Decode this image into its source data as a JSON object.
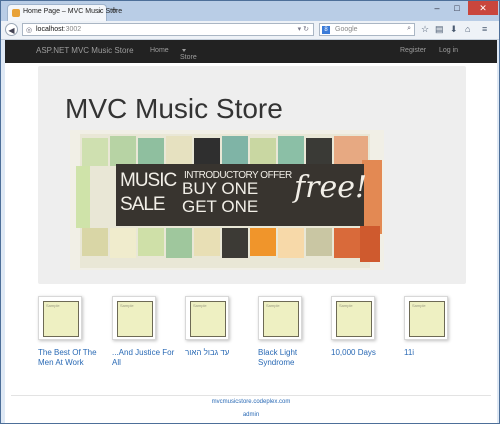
{
  "browser": {
    "tab_title": "Home Page – MVC Music Store",
    "tab_close": "×",
    "new_tab": "+",
    "min": "–",
    "max": "□",
    "close": "✕",
    "url_domain": "localhost",
    "url_port": ":3002",
    "search_engine_badge": "8",
    "search_placeholder": "Google",
    "toolbar_icons": [
      "star-icon",
      "clipboard-icon",
      "download-icon",
      "home-icon",
      "menu-icon"
    ]
  },
  "site_nav": {
    "brand": "ASP.NET MVC Music Store",
    "home": "Home",
    "store": "Store",
    "register": "Register",
    "login": "Log in"
  },
  "hero": {
    "heading": "MVC Music Store",
    "banner": {
      "music": "MUSIC",
      "sale": "SALE",
      "intro": "INTRODUCTORY OFFER",
      "buy_one": "BUY ONE",
      "get_one": "GET ONE",
      "free": "free!"
    }
  },
  "albums": [
    {
      "title": "The Best Of The Men At Work",
      "thumb": "Sample"
    },
    {
      "title": "...And Justice For All",
      "thumb": "Sample"
    },
    {
      "title": "עד גבול האור",
      "thumb": "Sample"
    },
    {
      "title": "Black Light Syndrome",
      "thumb": "Sample"
    },
    {
      "title": "10,000 Days",
      "thumb": "Sample"
    },
    {
      "title": "11i",
      "thumb": "Sample"
    }
  ],
  "footer": {
    "site_link": "mvcmusicstore.codeplex.com",
    "admin_link": "admin"
  },
  "colors": {
    "site_nav_bg": "#222222",
    "link": "#2a6ab5",
    "jumbotron_bg": "#eeeeee",
    "banner_panel": "#38342f"
  }
}
